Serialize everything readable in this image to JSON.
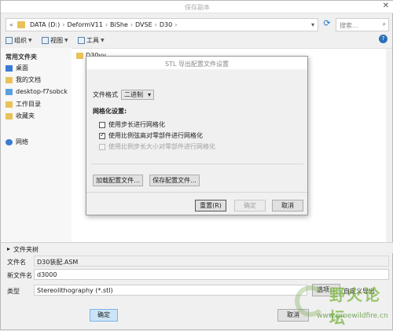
{
  "window": {
    "title": "保存副本",
    "close_glyph": "✕"
  },
  "address": {
    "prefix": "«",
    "crumbs": [
      "DATA (D:)",
      "DeformV11",
      "BiShe",
      "DVSE",
      "D30"
    ],
    "search_placeholder": "搜索..."
  },
  "toolbar": {
    "organize": "组织",
    "views": "视图",
    "tools": "工具",
    "help": "?"
  },
  "nav": {
    "header": "常用文件夹",
    "items": [
      {
        "label": "桌面",
        "icon": "desktop-icon"
      },
      {
        "label": "我的文档",
        "icon": "documents-icon"
      },
      {
        "label": "desktop-f7sobck",
        "icon": "computer-icon"
      },
      {
        "label": "工作目录",
        "icon": "working-dir-icon"
      },
      {
        "label": "收藏夹",
        "icon": "favorites-icon"
      },
      {
        "label": "网络",
        "icon": "network-icon"
      }
    ]
  },
  "files": [
    {
      "name": "D30vv"
    }
  ],
  "folder_tree": {
    "label": "文件夹树"
  },
  "fields": {
    "filename_label": "文件名",
    "filename_value": "D30装配.ASM",
    "newname_label": "新文件名",
    "newname_value": "d3000",
    "type_label": "类型",
    "type_value": "Stereolithography (*.stl)",
    "options_button": "选项...",
    "export_label": "自定义导出"
  },
  "dialog": {
    "title": "STL 导出配置文件设置",
    "format_label": "文件格式",
    "format_value": "二进制",
    "mesh_header": "网格化设置:",
    "options": [
      {
        "label": "使用步长进行网格化",
        "checked": false,
        "disabled": false
      },
      {
        "label": "使用比例弦高对零部件进行网格化",
        "checked": true,
        "disabled": false
      },
      {
        "label": "使用比例步长大小对零部件进行网格化",
        "checked": false,
        "disabled": true
      }
    ],
    "load_button": "加载配置文件...",
    "save_button": "保存配置文件...",
    "reset_button": "重置(R)",
    "ok_button": "确定",
    "cancel_button": "取消"
  },
  "bottom": {
    "ok": "确定",
    "cancel": "取消"
  },
  "watermark": {
    "logo_text": "野火论坛",
    "url": "www.proewildfire.cn"
  }
}
